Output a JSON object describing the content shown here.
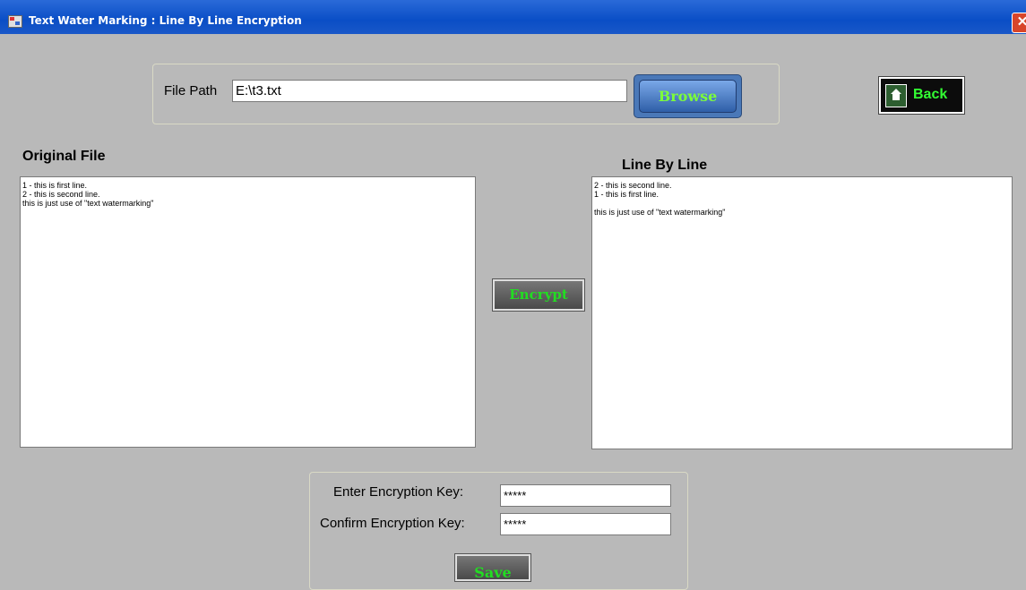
{
  "window": {
    "title": "Text Water Marking : Line By Line Encryption",
    "close_glyph": "✕"
  },
  "file": {
    "label": "File Path",
    "value": "E:\\t3.txt",
    "browse_label": "Browse",
    "back_label": "Back"
  },
  "original": {
    "heading": "Original File",
    "content": "1 - this is first line.\n2 - this is second line.\nthis is just use of \"text watermarking\""
  },
  "encrypted": {
    "heading": "Line By Line",
    "content": "2 - this is second line.\n1 - this is first line.\n\nthis is just use of \"text watermarking\""
  },
  "encrypt_label": "Encrypt",
  "keys": {
    "enter_label": "Enter Encryption Key:",
    "enter_value": "*****",
    "confirm_label": "Confirm Encryption Key:",
    "confirm_value": "*****",
    "save_label": "Save"
  },
  "icons": {
    "home": "home-icon",
    "app": "app-icon"
  }
}
